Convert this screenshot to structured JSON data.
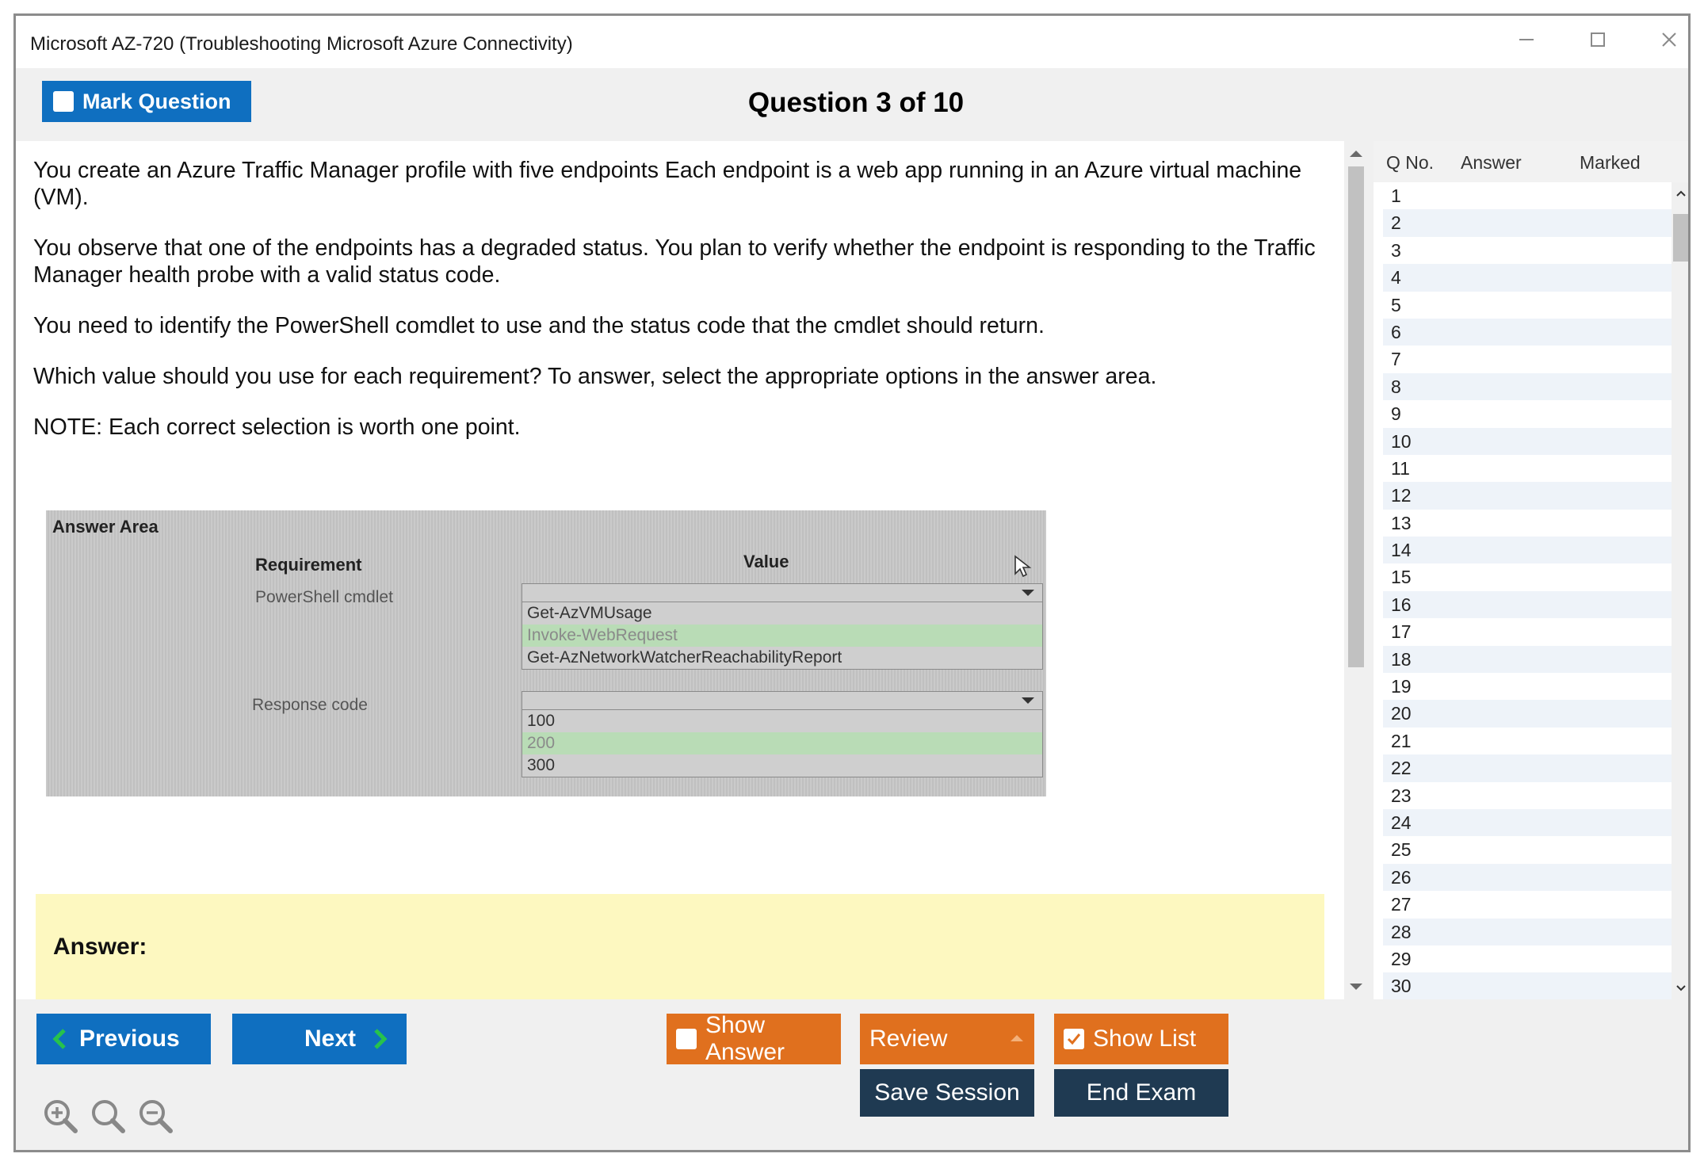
{
  "window": {
    "title": "Microsoft AZ-720 (Troubleshooting Microsoft Azure Connectivity)"
  },
  "header": {
    "mark_label": "Mark Question",
    "question_title": "Question 3 of 10"
  },
  "question": {
    "paragraphs": [
      "You create an Azure Traffic Manager profile with five endpoints Each endpoint is a web app running in an Azure virtual machine (VM).",
      "You observe that one of the endpoints has a degraded status. You plan to verify whether the endpoint is responding to the Traffic Manager health probe with a valid status code.",
      "You need to identify the PowerShell comdlet to use and the status code that the cmdlet should return.",
      "Which value should you use for each requirement? To answer, select the appropriate options in the answer area.",
      "NOTE: Each correct selection is worth one point."
    ]
  },
  "answer_area": {
    "title": "Answer Area",
    "requirement_header": "Requirement",
    "value_header": "Value",
    "rows": [
      {
        "label": "PowerShell cmdlet",
        "options": [
          "Get-AzVMUsage",
          "Invoke-WebRequest",
          "Get-AzNetworkWatcherReachabilityReport"
        ],
        "highlighted": "Invoke-WebRequest"
      },
      {
        "label": "Response code",
        "options": [
          "100",
          "200",
          "300"
        ],
        "highlighted": "200"
      }
    ]
  },
  "answer": {
    "label": "Answer:"
  },
  "question_list": {
    "headers": {
      "qno": "Q No.",
      "answer": "Answer",
      "marked": "Marked"
    },
    "rows": [
      "1",
      "2",
      "3",
      "4",
      "5",
      "6",
      "7",
      "8",
      "9",
      "10",
      "11",
      "12",
      "13",
      "14",
      "15",
      "16",
      "17",
      "18",
      "19",
      "20",
      "21",
      "22",
      "23",
      "24",
      "25",
      "26",
      "27",
      "28",
      "29",
      "30"
    ]
  },
  "footer": {
    "previous": "Previous",
    "next": "Next",
    "show_answer": "Show Answer",
    "review": "Review",
    "show_list": "Show List",
    "save_session": "Save Session",
    "end_exam": "End Exam"
  },
  "icons": {
    "minimize": "minimize-icon",
    "maximize": "maximize-icon",
    "close": "close-icon",
    "zoom_in": "zoom-in-icon",
    "zoom_reset": "zoom-reset-icon",
    "zoom_out": "zoom-out-icon"
  },
  "colors": {
    "primary_blue": "#0f6fc0",
    "orange": "#e0701e",
    "dark_navy": "#1f3a52",
    "answer_bg": "#fdf8c0",
    "highlight_green": "#b9dcb6",
    "chevron_green": "#27c24c"
  }
}
